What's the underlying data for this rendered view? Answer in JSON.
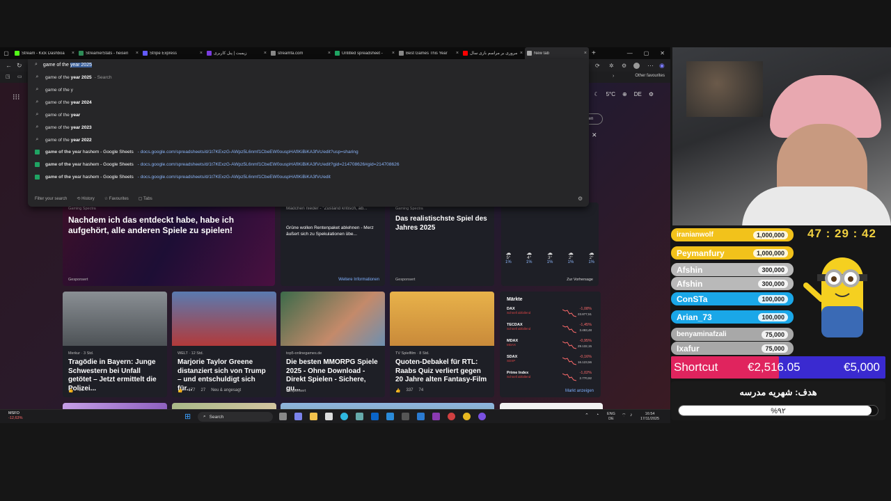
{
  "browser": {
    "tabs": [
      {
        "label": "Stream - Kick Dashboa",
        "color": "#53fc18"
      },
      {
        "label": "StreamerStats - heisen",
        "color": "#2e8b57"
      },
      {
        "label": "Stripe Express",
        "color": "#635bff"
      },
      {
        "label": "زیمبت | پنل کاربری",
        "color": "#7a3ce0"
      },
      {
        "label": "streamfa.com",
        "color": "#888888"
      },
      {
        "label": "Untitled spreadsheet -",
        "color": "#1fa463"
      },
      {
        "label": "Best Games This Year",
        "color": "#888888"
      },
      {
        "label": "مروری بر مراسم بازی سال",
        "color": "#ff0000"
      },
      {
        "label": "New tab",
        "color": "#aaaaaa"
      }
    ],
    "omnibox": {
      "typed_prefix": "game of the ",
      "typed_selected": "year 2025",
      "suggestions": [
        {
          "text": "game of the ",
          "bold": "year 2025",
          "hint": " - Search",
          "type": "search"
        },
        {
          "text": "game of the y",
          "bold": "",
          "hint": "",
          "type": "search"
        },
        {
          "text": "game of the ",
          "bold": "year 2024",
          "hint": "",
          "type": "search"
        },
        {
          "text": "game of the ",
          "bold": "year",
          "hint": "",
          "type": "search"
        },
        {
          "text": "game of the ",
          "bold": "year 2023",
          "hint": "",
          "type": "search"
        },
        {
          "text": "game of the ",
          "bold": "year 2022",
          "hint": "",
          "type": "search"
        },
        {
          "text": "game of the ye",
          "bold": "ar hashem - Google Sheets",
          "url": "docs.google.com/spreadsheets/d/1t7KExzG-AWpz5L6nmf1CbeEW0ouspHAfIKiBiKA3fVc/edit?usp=sharing",
          "type": "sheet"
        },
        {
          "text": "game of the ye",
          "bold": "ar hashem - Google Sheets",
          "url": "docs.google.com/spreadsheets/d/1t7KExzG-AWpz5L6nmf1CbeEW0ouspHAfIKiBiKA3fVc/edit?gid=214708626#gid=214708626",
          "type": "sheet"
        },
        {
          "text": "game of the ye",
          "bold": "ar hashem - Google Sheets",
          "url": "docs.google.com/spreadsheets/d/1t7KExzG-AWpz5L6nmf1CbeEW0ouspHAfIKiBiKA3fVc/edit",
          "type": "sheet"
        }
      ],
      "footer": {
        "filter": "Filter your search",
        "history": "History",
        "favourites": "Favourites",
        "tabs": "Tabs"
      }
    },
    "favbar": {
      "other": "Other favourites"
    },
    "weather": {
      "temp": "5°C",
      "lang": "DE"
    },
    "cards": [
      {
        "source": "Gaming Spectra",
        "title": "Nachdem ich das entdeckt habe, habe ich aufgehört, alle anderen Spiele zu spielen!",
        "ad": "Gesponsert"
      },
      {
        "source": "",
        "title": "Mädchen nieder - \"Zustand kritisch, ab...",
        "extra": "Grüne wollen Rentenpaket ablehnen - Merz äußert sich zu Spekulationen übe...",
        "link": "Weitere Informationen"
      },
      {
        "source": "Gaming Spectra",
        "title": "Das realistischste Spiel des Jahres 2025",
        "ad": "Gesponsert"
      },
      {
        "source": "Merkur · 3 Std.",
        "title": "Tragödie in Bayern: Junge Schwestern bei Unfall getötet – Jetzt ermittelt die Polizei...",
        "likes": "27"
      },
      {
        "source": "WELT · 12 Std.",
        "title": "Marjorie Taylor Greene distanziert sich von Trump – und entschuldigt sich für...",
        "likes": "177",
        "comments": "27",
        "tag": "Neu & angesagt"
      },
      {
        "source": "top5-onlinegames.de",
        "title": "Die besten MMORPG Spiele 2025 - Ohne Download - Direkt Spielen - Sichere, gu...",
        "ad": "Gesponsert"
      },
      {
        "source": "TV Spielfilm · 8 Std.",
        "title": "Quoten-Debakel für RTL: Raabs Quiz verliert gegen 20 Jahre alten Fantasy-Film",
        "likes": "337",
        "comments": "74"
      }
    ],
    "markets": {
      "title": "Märkte",
      "rows": [
        {
          "name": "DAX",
          "sub": "Schnell abfallend",
          "pct": "-1,08%",
          "val": "23.877,51"
        },
        {
          "name": "TECDAX",
          "sub": "Schnell abfallend",
          "pct": "-1,45%",
          "val": "3.493,48"
        },
        {
          "name": "MDAX",
          "sub": "MDAX",
          "pct": "-0,95%",
          "val": "29.132,15"
        },
        {
          "name": "SDAX",
          "sub": "SDXP",
          "pct": "-0,16%",
          "val": "16.123,56"
        },
        {
          "name": "Prime Index",
          "sub": "Schnell abfallend",
          "pct": "-1,02%",
          "val": "2.770,92"
        }
      ],
      "link": "Markt anzeigen"
    },
    "forecast": {
      "temps": [
        "5°",
        "4°",
        "3°",
        "2°",
        "2°"
      ],
      "rain": [
        "1%",
        "1%",
        "1%",
        "1%",
        "1%"
      ],
      "link": "Zur Vorhersage"
    }
  },
  "taskbar": {
    "stock_name": "MSFO",
    "stock_change": "-12,63%",
    "search": "Search",
    "lang_top": "ENG",
    "lang_bottom": "DE",
    "time": "16:54",
    "date": "17/11/2025"
  },
  "overlay": {
    "leaderboard": [
      {
        "name": "iranianwolf",
        "amount": "1,000,000",
        "color": "#f2c21b"
      },
      {
        "name": "Peymanfury",
        "amount": "1,000,000",
        "color": "#f2c21b"
      },
      {
        "name": "Afshin",
        "amount": "300,000",
        "color": "#b9b9b9"
      },
      {
        "name": "Afshin",
        "amount": "300,000",
        "color": "#b9b9b9"
      },
      {
        "name": "ConSTa",
        "amount": "100,000",
        "color": "#1aa7e8"
      },
      {
        "name": "Arian_73",
        "amount": "100,000",
        "color": "#1aa7e8"
      },
      {
        "name": "benyaminafzali",
        "amount": "75,000",
        "color": "#a8a8a8"
      },
      {
        "name": "Ixafur",
        "amount": "75,000",
        "color": "#a8a8a8"
      }
    ],
    "timer": "47 : 29 : 42",
    "goal_label": "Shortcut",
    "goal_current": "€2,516.05",
    "goal_target": "€5,000",
    "goal_progress": 0.5032,
    "goal_title": "هدف: شهریه مدرسه",
    "goal_percent_text": "%۹۲"
  }
}
